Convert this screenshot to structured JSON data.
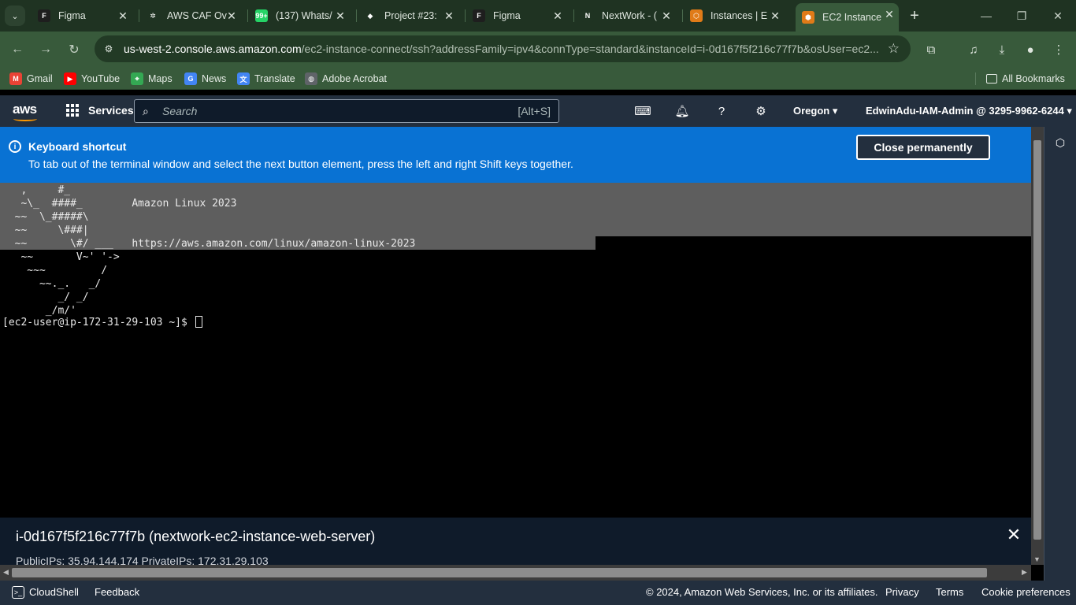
{
  "browser": {
    "tabs": [
      {
        "label": "Figma",
        "icon": "figma-icon",
        "color": "#1e1e1e",
        "glyph": "F"
      },
      {
        "label": "AWS CAF Ov",
        "icon": "chatgpt-icon",
        "color": "#1f3322",
        "glyph": "✲"
      },
      {
        "label": "(137) Whats/",
        "icon": "whatsapp-icon",
        "color": "#25d366",
        "glyph": "99+"
      },
      {
        "label": "Project #23:",
        "icon": "cube-icon",
        "color": "#1f3322",
        "glyph": "◆"
      },
      {
        "label": "Figma",
        "icon": "figma-icon",
        "color": "#1e1e1e",
        "glyph": "F"
      },
      {
        "label": "NextWork - (",
        "icon": "nextwork-icon",
        "color": "#1f3322",
        "glyph": "N"
      },
      {
        "label": "Instances | E",
        "icon": "aws-ec2-icon",
        "color": "#e07b18",
        "glyph": "⬡"
      },
      {
        "label": "EC2 Instance",
        "icon": "aws-ec2-icon",
        "color": "#e07b18",
        "glyph": "⬢"
      }
    ],
    "url_host": "us-west-2.console.aws.amazon.com",
    "url_path": "/ec2-instance-connect/ssh?addressFamily=ipv4&connType=standard&instanceId=i-0d167f5f216c77f7b&osUser=ec2...",
    "bookmarks": [
      {
        "label": "Gmail",
        "icon": "gmail-icon",
        "color": "#ea4335",
        "glyph": "M"
      },
      {
        "label": "YouTube",
        "icon": "youtube-icon",
        "color": "#ff0000",
        "glyph": "▶"
      },
      {
        "label": "Maps",
        "icon": "maps-icon",
        "color": "#34a853",
        "glyph": "⌖"
      },
      {
        "label": "News",
        "icon": "news-icon",
        "color": "#4285f4",
        "glyph": "G"
      },
      {
        "label": "Translate",
        "icon": "translate-icon",
        "color": "#4285f4",
        "glyph": "文"
      },
      {
        "label": "Adobe Acrobat",
        "icon": "globe-icon",
        "color": "#5f6368",
        "glyph": "◍"
      }
    ],
    "all_bookmarks": "All Bookmarks"
  },
  "aws": {
    "logo": "aws",
    "services": "Services",
    "search_placeholder": "Search",
    "search_shortcut": "[Alt+S]",
    "region": "Oregon",
    "account": "EdwinAdu-IAM-Admin @ 3295-9962-6244"
  },
  "flash": {
    "title": "Keyboard shortcut",
    "body": "To tab out of the terminal window and select the next button element, press the left and right Shift keys together.",
    "button": "Close permanently"
  },
  "terminal": {
    "lines": [
      "   ,     #_",
      "   ~\\_  ####_        Amazon Linux 2023",
      "  ~~  \\_#####\\",
      "  ~~     \\###|",
      "  ~~       \\#/ ___   https://aws.amazon.com/linux/amazon-linux-2023",
      "   ~~       V~' '->",
      "    ~~~         /",
      "      ~~._.   _/",
      "         _/ _/",
      "       _/m/'"
    ],
    "prompt": "[ec2-user@ip-172-31-29-103 ~]$ "
  },
  "instance": {
    "title": "i-0d167f5f216c77f7b (nextwork-ec2-instance-web-server)",
    "ips": "PublicIPs: 35.94.144.174   PrivateIPs: 172.31.29.103"
  },
  "footer": {
    "cloudshell": "CloudShell",
    "feedback": "Feedback",
    "copyright": "© 2024, Amazon Web Services, Inc. or its affiliates.",
    "privacy": "Privacy",
    "terms": "Terms",
    "cookies": "Cookie preferences"
  }
}
